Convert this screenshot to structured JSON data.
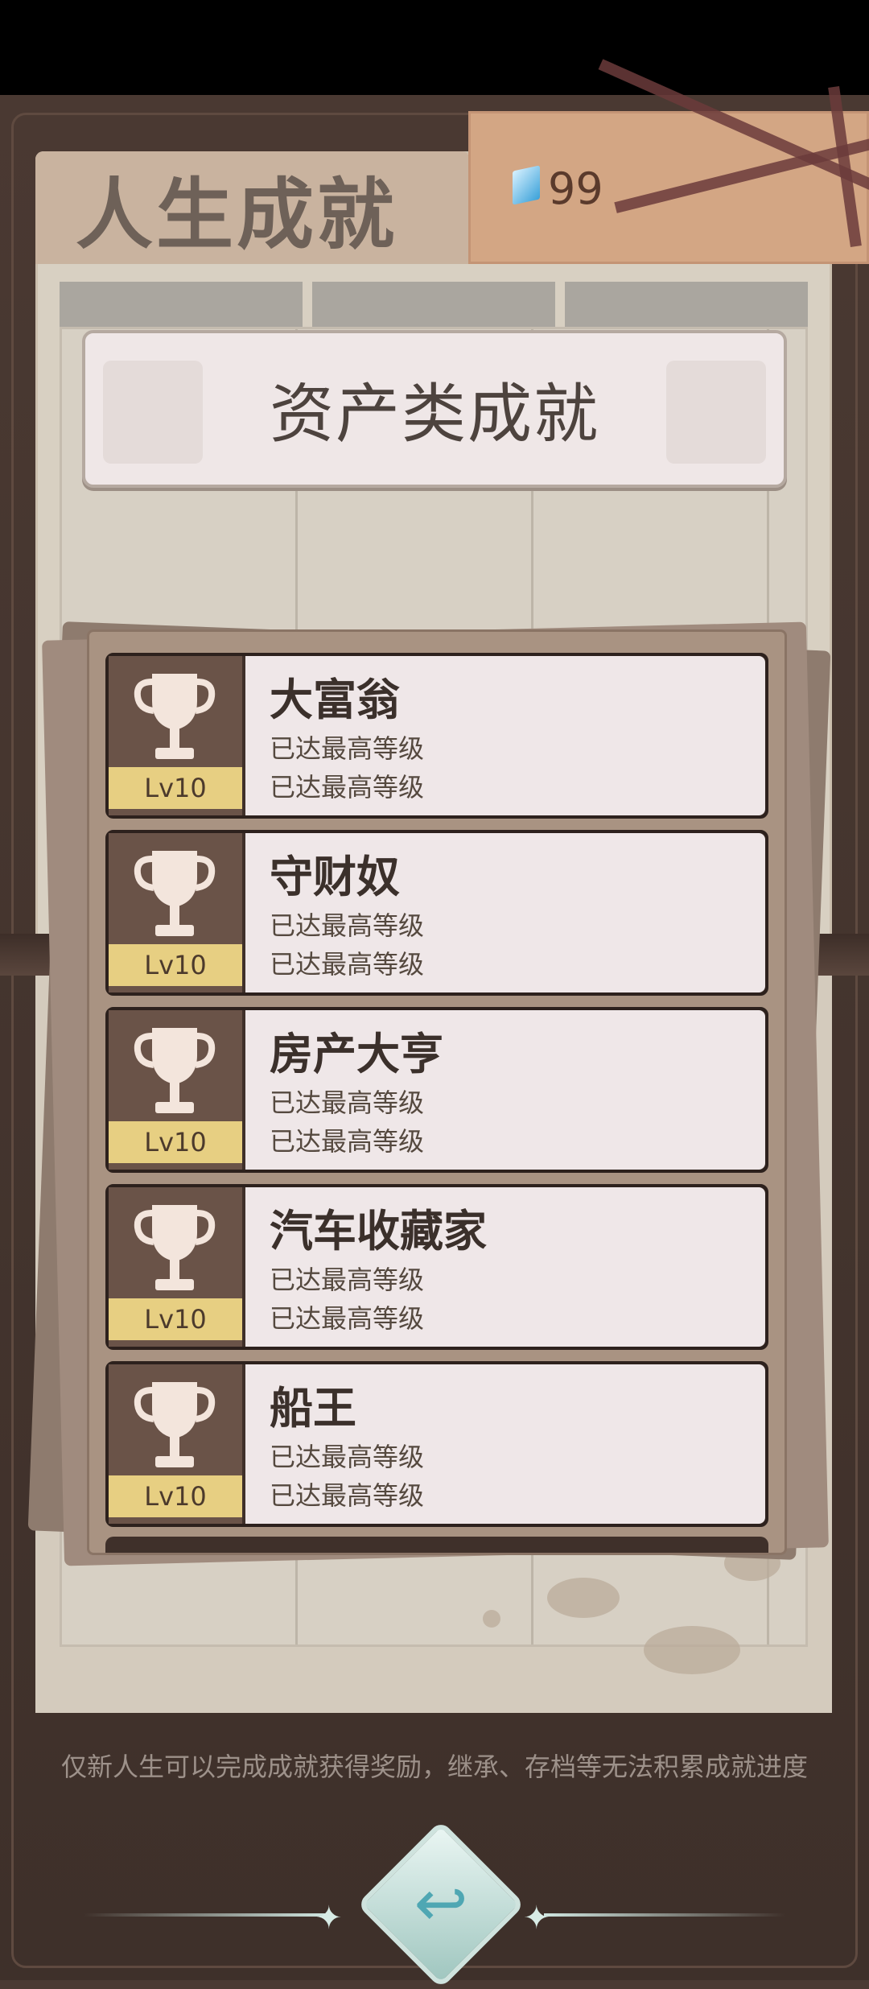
{
  "header": {
    "title": "人生成就",
    "currency_value": "99"
  },
  "category": {
    "title": "资产类成就"
  },
  "achievements": [
    {
      "name": "大富翁",
      "level": "Lv10",
      "line1": "已达最高等级",
      "line2": "已达最高等级"
    },
    {
      "name": "守财奴",
      "level": "Lv10",
      "line1": "已达最高等级",
      "line2": "已达最高等级"
    },
    {
      "name": "房产大亨",
      "level": "Lv10",
      "line1": "已达最高等级",
      "line2": "已达最高等级"
    },
    {
      "name": "汽车收藏家",
      "level": "Lv10",
      "line1": "已达最高等级",
      "line2": "已达最高等级"
    },
    {
      "name": "船王",
      "level": "Lv10",
      "line1": "已达最高等级",
      "line2": "已达最高等级"
    }
  ],
  "footer": {
    "notice": "仅新人生可以完成成就获得奖励，继承、存档等无法积累成就进度"
  },
  "icons": {
    "currency": "gem-icon",
    "trophy": "trophy-icon",
    "back": "return-arrow-icon"
  },
  "colors": {
    "background": "#4b3a33",
    "paper": "#d8d0c2",
    "card": "#efe7e8",
    "level_badge": "#e7cf82",
    "back_button": "#9fc6bf"
  }
}
